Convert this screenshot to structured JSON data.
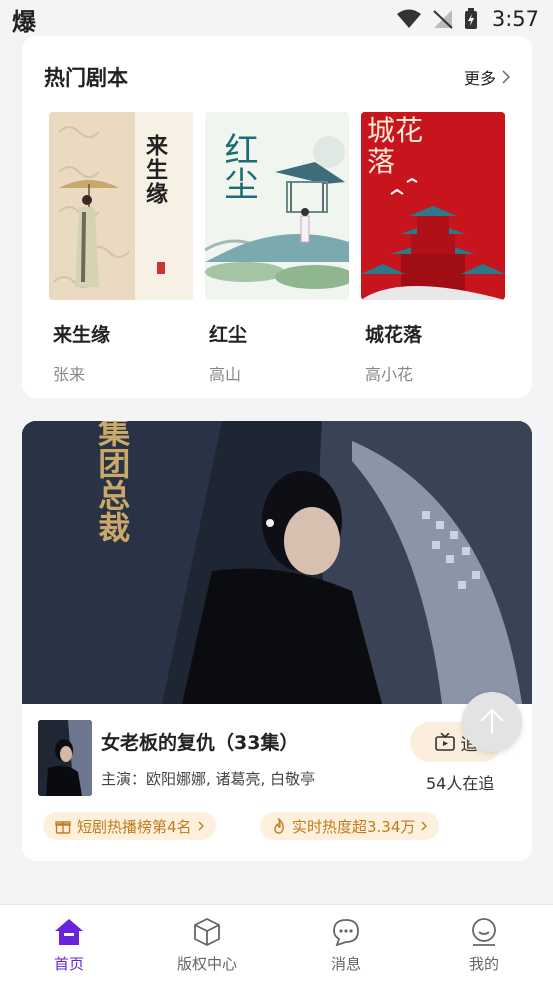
{
  "status_bar": {
    "left_glyph": "爆",
    "time": "3:57"
  },
  "hot_scripts": {
    "title": "热门剧本",
    "more_label": "更多",
    "books": [
      {
        "title": "来生缘",
        "author": "张来",
        "cover_text": "来生缘"
      },
      {
        "title": "红尘",
        "author": "高山",
        "cover_text": "红尘"
      },
      {
        "title": "城花落",
        "author": "高小花",
        "cover_text": "城花落"
      }
    ]
  },
  "drama": {
    "title": "女老板的复仇（33集）",
    "cast": "主演：欧阳娜娜, 诸葛亮, 白敬亭",
    "follow_label": "追",
    "follow_count": "54人在追",
    "video_overlay_text": "集团总裁",
    "badges": [
      {
        "label": "短剧热播榜第4名",
        "icon": "gift-icon"
      },
      {
        "label": "实时热度超3.34万",
        "icon": "flame-icon"
      }
    ]
  },
  "bottom_nav": {
    "items": [
      {
        "label": "首页",
        "icon": "home-icon",
        "active": true
      },
      {
        "label": "版权中心",
        "icon": "box-icon",
        "active": false
      },
      {
        "label": "消息",
        "icon": "chat-icon",
        "active": false
      },
      {
        "label": "我的",
        "icon": "profile-icon",
        "active": false
      }
    ]
  },
  "colors": {
    "accent": "#6a23d8",
    "badge_text": "#c27a1e",
    "badge_bg": "#fdf1de"
  }
}
